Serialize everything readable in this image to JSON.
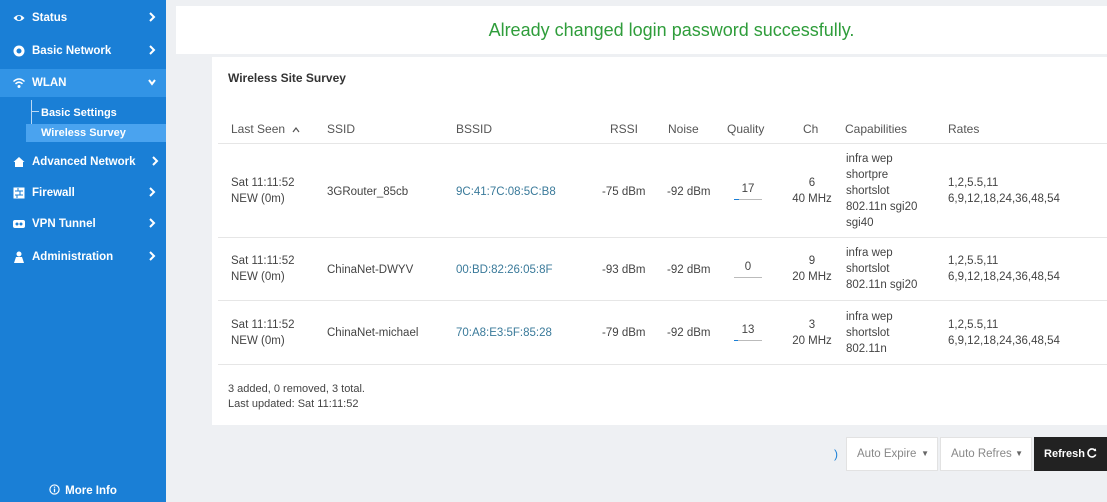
{
  "sidebar": {
    "items": [
      {
        "label": "Status",
        "icon": "eye-icon"
      },
      {
        "label": "Basic Network",
        "icon": "globe-icon"
      },
      {
        "label": "WLAN",
        "icon": "wifi-icon"
      },
      {
        "label": "Advanced Network",
        "icon": "house-icon"
      },
      {
        "label": "Firewall",
        "icon": "firewall-icon"
      },
      {
        "label": "VPN Tunnel",
        "icon": "vpn-icon"
      },
      {
        "label": "Administration",
        "icon": "admin-icon"
      }
    ],
    "wlan_submenu": [
      {
        "label": "Basic Settings"
      },
      {
        "label": "Wireless Survey"
      }
    ],
    "more_info": "More Info"
  },
  "banner": {
    "message": "Already changed login password successfully."
  },
  "survey": {
    "title": "Wireless Site Survey",
    "columns": {
      "last_seen": "Last Seen",
      "ssid": "SSID",
      "bssid": "BSSID",
      "rssi": "RSSI",
      "noise": "Noise",
      "quality": "Quality",
      "ch": "Ch",
      "capabilities": "Capabilities",
      "rates": "Rates"
    },
    "rows": [
      {
        "last_seen_1": "Sat 11:11:52",
        "last_seen_2": "NEW (0m)",
        "ssid": "3GRouter_85cb",
        "bssid": "9C:41:7C:08:5C:B8",
        "rssi": "-75 dBm",
        "noise": "-92 dBm",
        "quality": "17",
        "quality_fraction": 0.17,
        "ch_1": "6",
        "ch_2": "40 MHz",
        "cap_1": "infra wep",
        "cap_2": "shortpre",
        "cap_3": "shortslot",
        "cap_4": "802.11n sgi20",
        "cap_5": "sgi40",
        "rates_1": "1,2,5.5,11",
        "rates_2": "6,9,12,18,24,36,48,54"
      },
      {
        "last_seen_1": "Sat 11:11:52",
        "last_seen_2": "NEW (0m)",
        "ssid": "ChinaNet-DWYV",
        "bssid": "00:BD:82:26:05:8F",
        "rssi": "-93 dBm",
        "noise": "-92 dBm",
        "quality": "0",
        "quality_fraction": 0,
        "ch_1": "9",
        "ch_2": "20 MHz",
        "cap_1": "infra wep",
        "cap_2": "shortslot",
        "cap_3": "802.11n sgi20",
        "rates_1": "1,2,5.5,11",
        "rates_2": "6,9,12,18,24,36,48,54"
      },
      {
        "last_seen_1": "Sat 11:11:52",
        "last_seen_2": "NEW (0m)",
        "ssid": "ChinaNet-michael",
        "bssid": "70:A8:E3:5F:85:28",
        "rssi": "-79 dBm",
        "noise": "-92 dBm",
        "quality": "13",
        "quality_fraction": 0.13,
        "ch_1": "3",
        "ch_2": "20 MHz",
        "cap_1": "infra wep",
        "cap_2": "shortslot",
        "cap_3": "802.11n",
        "rates_1": "1,2,5.5,11",
        "rates_2": "6,9,12,18,24,36,48,54"
      }
    ],
    "summary": "3 added, 0 removed, 3 total.",
    "last_updated": "Last updated: Sat 11:11:52"
  },
  "controls": {
    "link_glyph": ")",
    "auto_expire": "Auto Expire",
    "auto_refresh": "Auto Refres",
    "refresh_label": "Refresh"
  },
  "colors": {
    "sidebar": "#1a7fd6",
    "sidebar_open": "#3294e6",
    "sidebar_active": "#4aa3ef",
    "success_text": "#2f9d3b",
    "rates_b": "#2d3bbf",
    "rates_g": "#3b8a2e",
    "refresh_button": "#222222"
  }
}
